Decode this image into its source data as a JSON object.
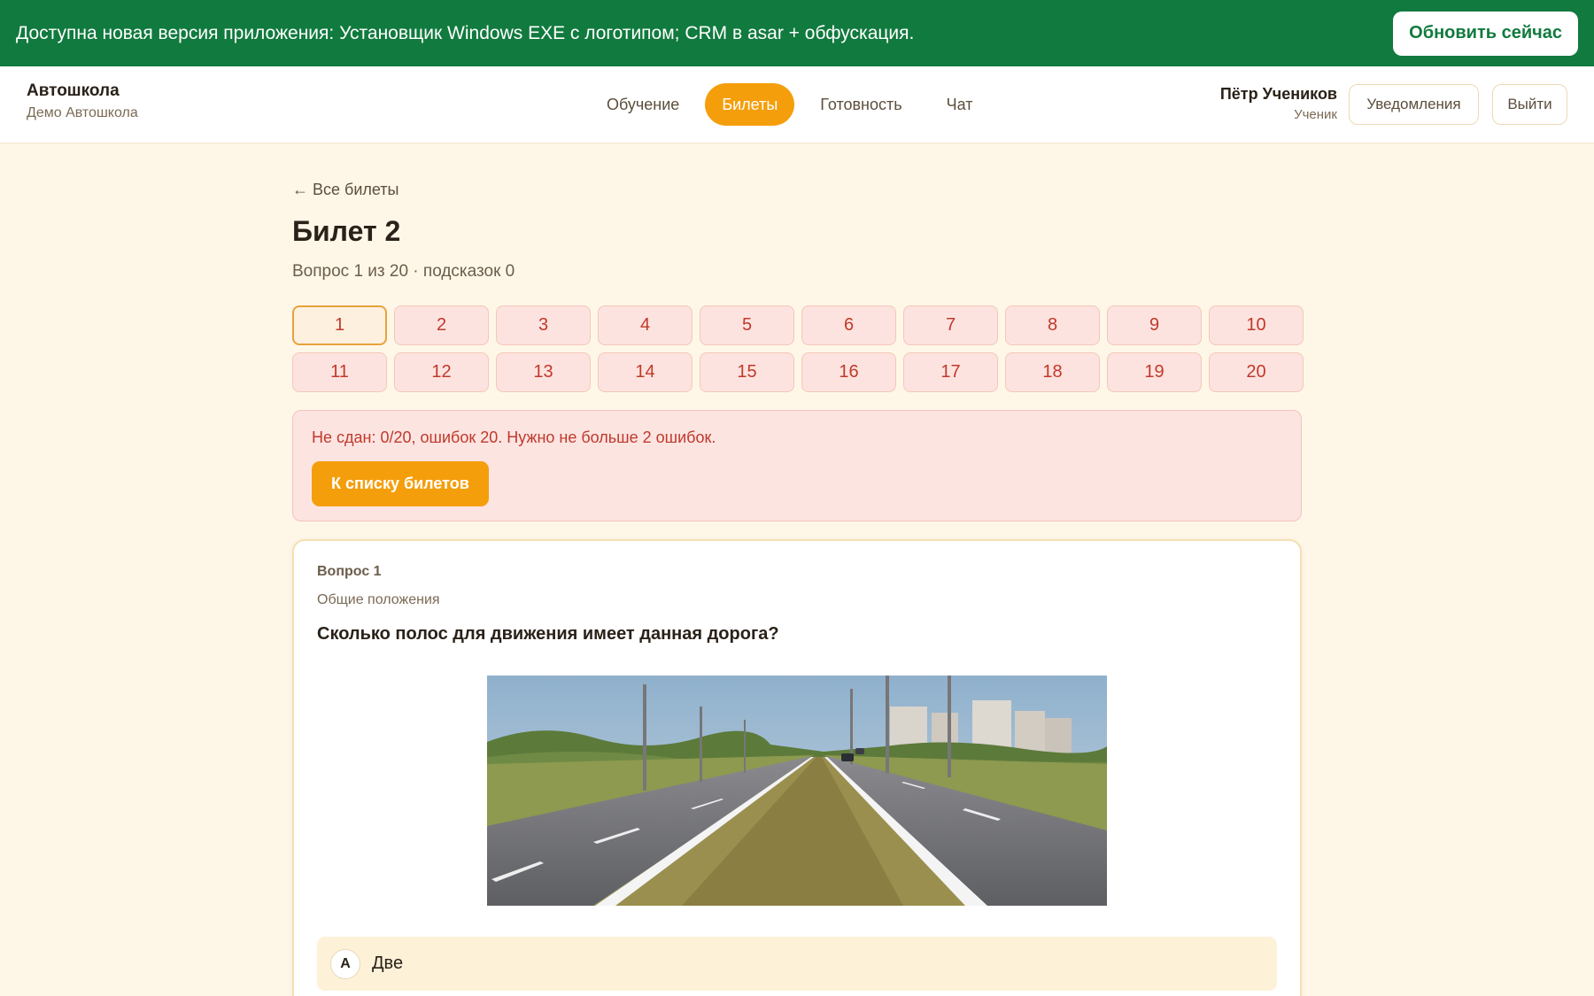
{
  "banner": {
    "text": "Доступна новая версия приложения: Установщик Windows EXE с логотипом; CRM в asar + обфускация.",
    "button_label": "Обновить сейчас"
  },
  "header": {
    "brand_name": "Автошкола",
    "brand_sub": "Демо Автошкола",
    "nav": [
      {
        "label": "Обучение",
        "active": false
      },
      {
        "label": "Билеты",
        "active": true
      },
      {
        "label": "Готовность",
        "active": false
      },
      {
        "label": "Чат",
        "active": false
      }
    ],
    "user_name": "Пётр Учеников",
    "user_role": "Ученик",
    "notifications_label": "Уведомления",
    "logout_label": "Выйти"
  },
  "ticket": {
    "back_label": "← Все билеты",
    "title": "Билет 2",
    "progress": "Вопрос 1 из 20 · подсказок 0",
    "questions": [
      "1",
      "2",
      "3",
      "4",
      "5",
      "6",
      "7",
      "8",
      "9",
      "10",
      "11",
      "12",
      "13",
      "14",
      "15",
      "16",
      "17",
      "18",
      "19",
      "20"
    ],
    "current_question": 1
  },
  "result": {
    "text": "Не сдан: 0/20, ошибок 20. Нужно не больше 2 ошибок.",
    "button_label": "К списку билетов"
  },
  "question": {
    "number_label": "Вопрос 1",
    "section": "Общие положения",
    "text": "Сколько полос для движения имеет данная дорога?",
    "answers": [
      {
        "letter": "А",
        "text": "Две"
      }
    ]
  },
  "colors": {
    "banner": "#117a3e",
    "accent": "#f59e0b",
    "background": "#fef7e8",
    "error": "#c0392b"
  }
}
